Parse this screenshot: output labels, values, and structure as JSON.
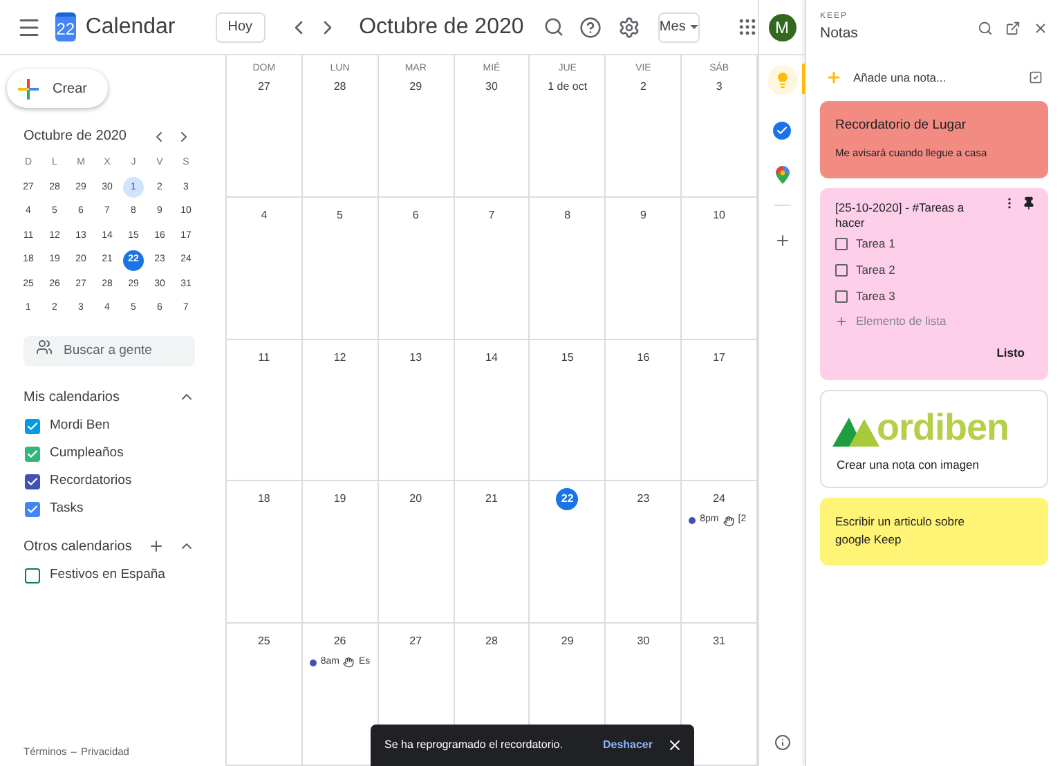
{
  "header": {
    "logo_day": "22",
    "app_name": "Calendar",
    "today_button": "Hoy",
    "title": "Octubre de 2020",
    "view_select": "Mes",
    "avatar": "M"
  },
  "sidebar": {
    "create_button": "Crear",
    "mini_calendar": {
      "title": "Octubre de 2020",
      "weekdays": [
        "D",
        "L",
        "M",
        "X",
        "J",
        "V",
        "S"
      ],
      "weeks": [
        [
          {
            "day": "27",
            "selected": false
          },
          {
            "day": "28",
            "selected": false
          },
          {
            "day": "29",
            "selected": false
          },
          {
            "day": "30",
            "selected": false
          },
          {
            "day": "1",
            "selected": false,
            "highlighted": true
          },
          {
            "day": "2",
            "selected": false
          },
          {
            "day": "3",
            "selected": false
          }
        ],
        [
          {
            "day": "4",
            "selected": false
          },
          {
            "day": "5",
            "selected": false
          },
          {
            "day": "6",
            "selected": false
          },
          {
            "day": "7",
            "selected": false
          },
          {
            "day": "8",
            "selected": false
          },
          {
            "day": "9",
            "selected": false
          },
          {
            "day": "10",
            "selected": false
          }
        ],
        [
          {
            "day": "11",
            "selected": false
          },
          {
            "day": "12",
            "selected": false
          },
          {
            "day": "13",
            "selected": false
          },
          {
            "day": "14",
            "selected": false
          },
          {
            "day": "15",
            "selected": false
          },
          {
            "day": "16",
            "selected": false
          },
          {
            "day": "17",
            "selected": false
          }
        ],
        [
          {
            "day": "18",
            "selected": false
          },
          {
            "day": "19",
            "selected": false
          },
          {
            "day": "20",
            "selected": false
          },
          {
            "day": "21",
            "selected": false
          },
          {
            "day": "22",
            "selected": true
          },
          {
            "day": "23",
            "selected": false
          },
          {
            "day": "24",
            "selected": false
          }
        ],
        [
          {
            "day": "25",
            "selected": false
          },
          {
            "day": "26",
            "selected": false
          },
          {
            "day": "27",
            "selected": false
          },
          {
            "day": "28",
            "selected": false
          },
          {
            "day": "29",
            "selected": false
          },
          {
            "day": "30",
            "selected": false
          },
          {
            "day": "31",
            "selected": false
          }
        ],
        [
          {
            "day": "1",
            "selected": false
          },
          {
            "day": "2",
            "selected": false
          },
          {
            "day": "3",
            "selected": false
          },
          {
            "day": "4",
            "selected": false
          },
          {
            "day": "5",
            "selected": false
          },
          {
            "day": "6",
            "selected": false
          },
          {
            "day": "7",
            "selected": false
          }
        ]
      ]
    },
    "people_search": {
      "placeholder": "Buscar a gente"
    },
    "my_calendars": {
      "title": "Mis calendarios",
      "expanded": true,
      "items": [
        {
          "label": "Mordi Ben",
          "checked": true,
          "color": "#039be5"
        },
        {
          "label": "Cumpleaños",
          "checked": true,
          "color": "#33b679"
        },
        {
          "label": "Recordatorios",
          "checked": true,
          "color": "#3f51b5"
        },
        {
          "label": "Tasks",
          "checked": true,
          "color": "#4285f4"
        }
      ]
    },
    "other_calendars": {
      "title": "Otros calendarios",
      "expanded": true,
      "items": [
        {
          "label": "Festivos en España",
          "checked": false,
          "color": "#0b8043"
        }
      ]
    },
    "footer": {
      "links": [
        "Términos",
        "Privacidad"
      ],
      "separator": "–"
    }
  },
  "month_grid": {
    "weekdays": [
      "DOM",
      "LUN",
      "MAR",
      "MIÉ",
      "JUE",
      "VIE",
      "SÁB"
    ],
    "weeks": [
      [
        {
          "day": "27",
          "today": false
        },
        {
          "day": "28",
          "today": false
        },
        {
          "day": "29",
          "today": false
        },
        {
          "day": "30",
          "today": false
        },
        {
          "day": "1 de oct",
          "today": false
        },
        {
          "day": "2",
          "today": false
        },
        {
          "day": "3",
          "today": false
        }
      ],
      [
        {
          "day": "4",
          "today": false
        },
        {
          "day": "5",
          "today": false
        },
        {
          "day": "6",
          "today": false
        },
        {
          "day": "7",
          "today": false
        },
        {
          "day": "8",
          "today": false
        },
        {
          "day": "9",
          "today": false
        },
        {
          "day": "10",
          "today": false
        }
      ],
      [
        {
          "day": "11",
          "today": false
        },
        {
          "day": "12",
          "today": false
        },
        {
          "day": "13",
          "today": false
        },
        {
          "day": "14",
          "today": false
        },
        {
          "day": "15",
          "today": false
        },
        {
          "day": "16",
          "today": false
        },
        {
          "day": "17",
          "today": false
        }
      ],
      [
        {
          "day": "18",
          "today": false
        },
        {
          "day": "19",
          "today": false
        },
        {
          "day": "20",
          "today": false
        },
        {
          "day": "21",
          "today": false
        },
        {
          "day": "22",
          "today": true
        },
        {
          "day": "23",
          "today": false
        },
        {
          "day": "24",
          "today": false,
          "events": [
            {
              "time": "8pm",
              "title": "[2",
              "color": "#3f51b5"
            }
          ]
        }
      ],
      [
        {
          "day": "25",
          "today": false
        },
        {
          "day": "26",
          "today": false,
          "events": [
            {
              "time": "8am",
              "title": "Es",
              "color": "#3f51b5"
            }
          ]
        },
        {
          "day": "27",
          "today": false
        },
        {
          "day": "28",
          "today": false
        },
        {
          "day": "29",
          "today": false
        },
        {
          "day": "30",
          "today": false
        },
        {
          "day": "31",
          "today": false
        }
      ]
    ]
  },
  "snackbar": {
    "message": "Se ha reprogramado el recordatorio.",
    "action": "Deshacer"
  },
  "keep_panel": {
    "overline": "KEEP",
    "title": "Notas",
    "add_note": {
      "placeholder": "Añade una nota..."
    },
    "notes": [
      {
        "kind": "text",
        "color": "#f28b82",
        "title": "Recordatorio de Lugar",
        "body": "Me avisará cuando llegue a casa"
      },
      {
        "kind": "checklist",
        "color": "#fdcfe8",
        "title": "[25-10-2020] - #Tareas a hacer",
        "pinned": true,
        "items": [
          {
            "label": "Tarea 1",
            "checked": false
          },
          {
            "label": "Tarea 2",
            "checked": false
          },
          {
            "label": "Tarea 3",
            "checked": false
          }
        ],
        "add_item": "Elemento de lista",
        "done_button": "Listo"
      },
      {
        "kind": "image",
        "color": "#ffffff",
        "logo_text": "ordiben",
        "caption": "Crear una nota con imagen"
      },
      {
        "kind": "text",
        "color": "#fff475",
        "body": "Escribir un articulo sobre google Keep"
      }
    ]
  }
}
